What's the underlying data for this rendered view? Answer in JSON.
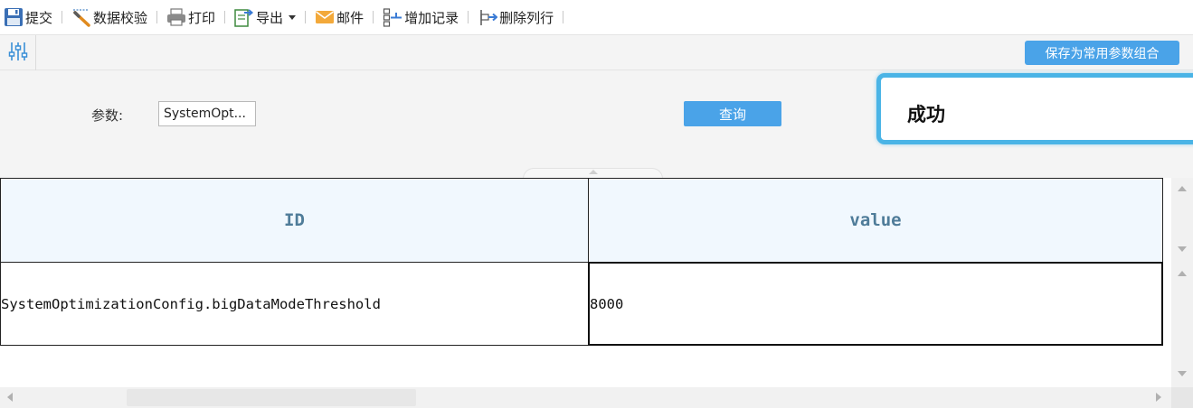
{
  "toolbar": {
    "items": [
      {
        "label": "提交",
        "icon": "save-icon"
      },
      {
        "label": "数据校验",
        "icon": "validate-icon"
      },
      {
        "label": "打印",
        "icon": "print-icon"
      },
      {
        "label": "导出",
        "icon": "export-icon"
      },
      {
        "label": "邮件",
        "icon": "mail-icon"
      },
      {
        "label": "增加记录",
        "icon": "add-record-icon"
      },
      {
        "label": "删除列行",
        "icon": "delete-row-icon"
      }
    ]
  },
  "param_bar": {
    "save_combo_label": "保存为常用参数组合"
  },
  "query": {
    "param_label": "参数:",
    "param_value": "SystemOpt...",
    "query_button_label": "查询"
  },
  "toast": {
    "message": "成功"
  },
  "table": {
    "columns": [
      "ID",
      "value"
    ],
    "rows": [
      [
        "SystemOptimizationConfig.bigDataModeThreshold",
        "8000"
      ]
    ]
  },
  "colors": {
    "accent": "#4aa3e8",
    "toast_border": "#4ab4e6",
    "header_bg": "#f1f8fe",
    "header_text": "#4f7c99"
  }
}
